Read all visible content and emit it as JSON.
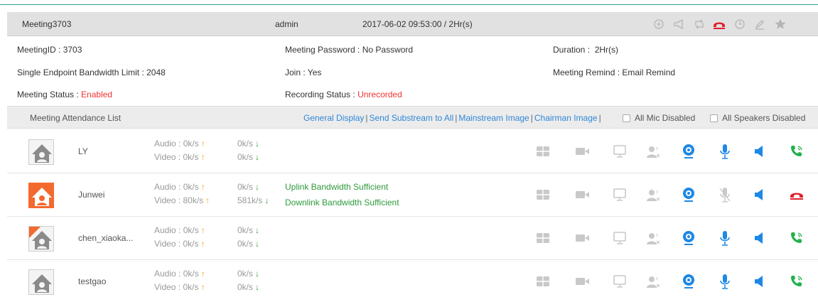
{
  "header": {
    "meeting_name": "Meeting3703",
    "owner": "admin",
    "time": "2017-06-02 09:53:00 / 2Hr(s)",
    "tools": [
      "zoom-icon",
      "megaphone-icon",
      "loop-icon",
      "hangup-icon",
      "clock-icon",
      "edit-icon",
      "star-icon"
    ]
  },
  "info": {
    "meeting_id": "MeetingID : 3703",
    "password": "Meeting Password : No Password",
    "duration": "Duration :  2Hr(s)",
    "bandwidth_limit": "Single Endpoint Bandwidth Limit : 2048",
    "join": "Join : Yes",
    "remind": "Meeting Remind : Email Remind",
    "status_label": "Meeting Status : ",
    "status_value": "Enabled",
    "recording_label": "Recording Status : ",
    "recording_value": "Unrecorded"
  },
  "attendance": {
    "title": "Meeting Attendance List",
    "links": [
      "General Display",
      "Send Substream to All",
      "Mainstream Image",
      "Chairman Image"
    ],
    "checkbox_mic": "All Mic Disabled",
    "checkbox_speakers": "All Speakers Disabled"
  },
  "participants": [
    {
      "name": "LY",
      "audio": "Audio : 0k/s",
      "video": "Video : 0k/s",
      "audio_down": "0k/s",
      "video_down": "0k/s",
      "uplink": "",
      "downlink": ""
    },
    {
      "name": "Junwei",
      "audio": "Audio : 0k/s",
      "video": "Video : 80k/s",
      "audio_down": "0k/s",
      "video_down": "581k/s",
      "uplink": "Uplink Bandwidth Sufficient",
      "downlink": "Downlink Bandwidth Sufficient"
    },
    {
      "name": "chen_xiaoka...",
      "audio": "Audio : 0k/s",
      "video": "Video : 0k/s",
      "audio_down": "0k/s",
      "video_down": "0k/s",
      "uplink": "",
      "downlink": ""
    },
    {
      "name": "testgao",
      "audio": "Audio : 0k/s",
      "video": "Video : 0k/s",
      "audio_down": "0k/s",
      "video_down": "0k/s",
      "uplink": "",
      "downlink": ""
    }
  ],
  "colors": {
    "accent_blue": "#2f87d8",
    "green": "#2e9a3a",
    "red": "#e33",
    "orange": "#f36a2f"
  }
}
